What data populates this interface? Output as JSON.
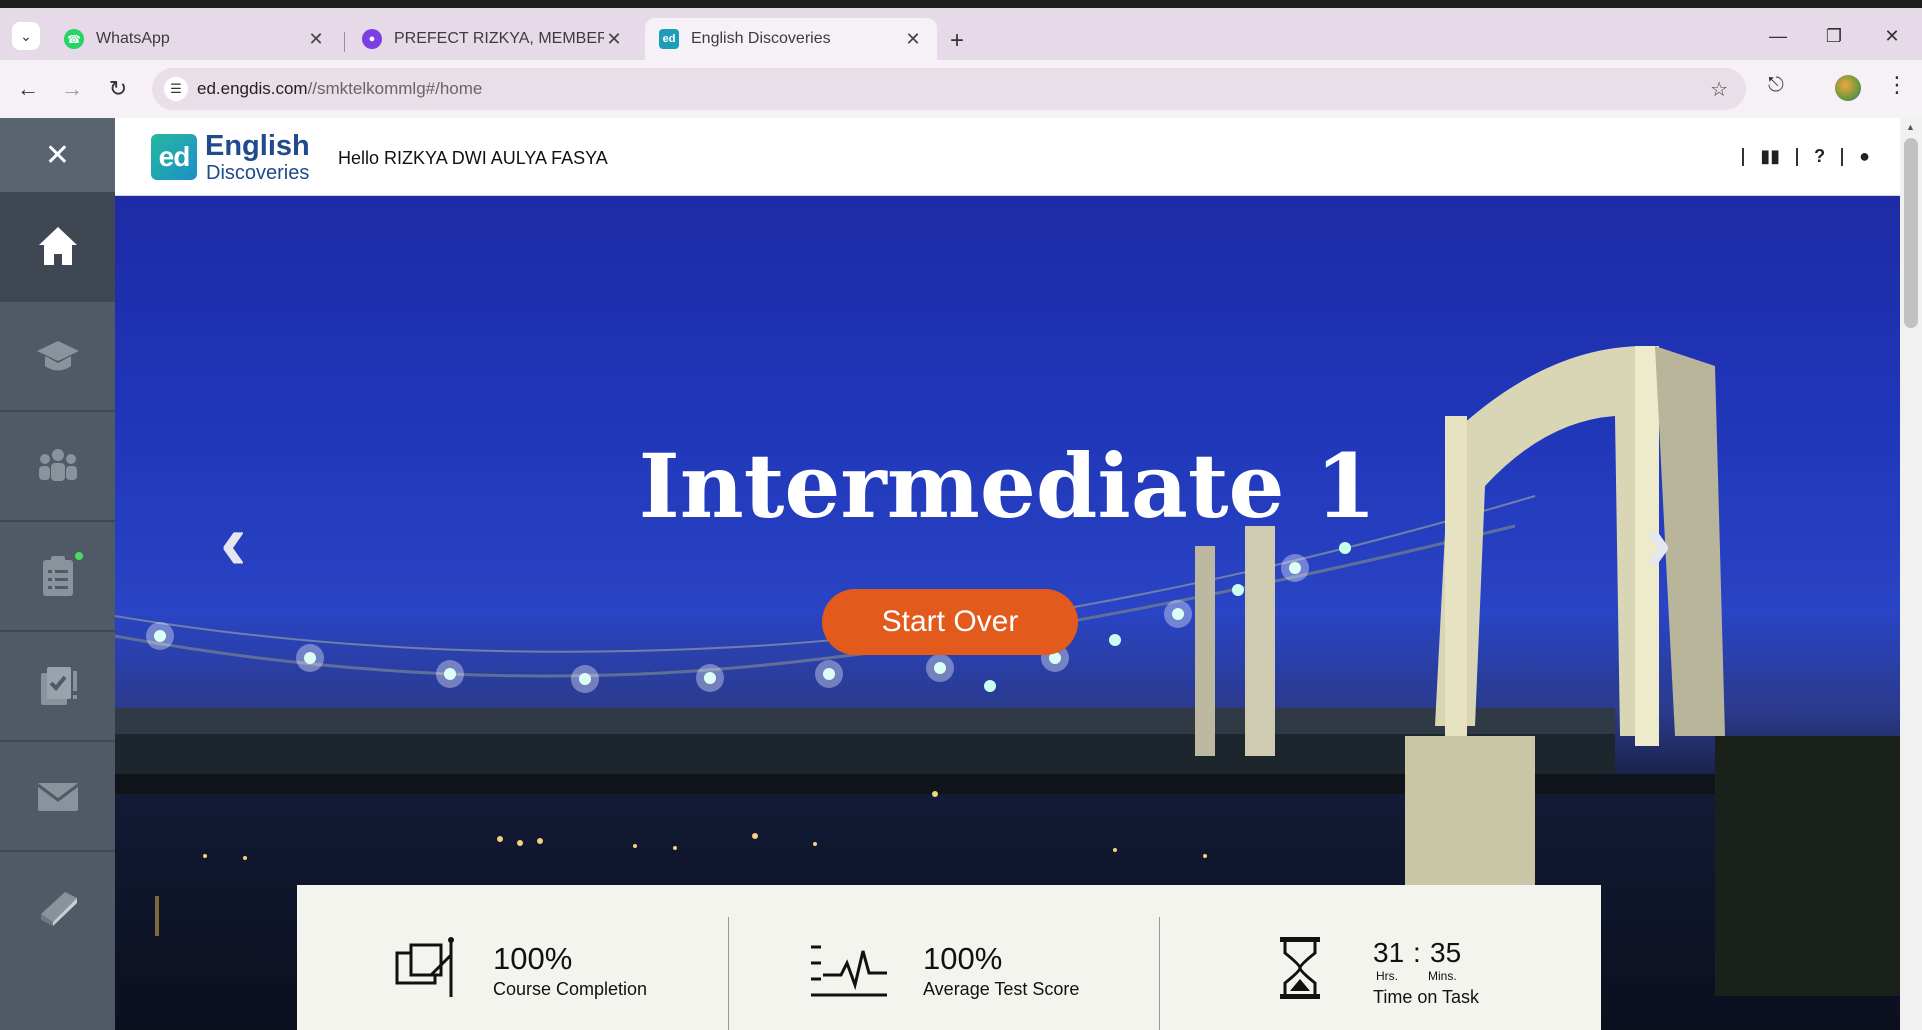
{
  "browser": {
    "tabs": [
      {
        "title": "WhatsApp",
        "icon": "whatsapp-icon",
        "color": "#25d366"
      },
      {
        "title": "PREFECT RIZKYA, MEMBER CINE",
        "icon": "canva-icon",
        "color": "#7b3fe4"
      },
      {
        "title": "English Discoveries",
        "icon": "ed-icon",
        "color": "#1e9db8"
      }
    ],
    "url_host": "ed.engdis.com",
    "url_path": "//smktelkommlg#/home"
  },
  "header": {
    "logo_mark": "ed",
    "logo_line1": "English",
    "logo_line2": "Discoveries",
    "greeting": "Hello RIZKYA DWI AULYA FASYA"
  },
  "hero": {
    "title": "Intermediate 1",
    "button_label": "Start Over"
  },
  "stats": {
    "completion_value": "100%",
    "completion_label": "Course Completion",
    "test_value": "100%",
    "test_label": "Average Test Score",
    "time_hours": "31",
    "time_colon": ":",
    "time_minutes": "35",
    "hours_label": "Hrs.",
    "minutes_label": "Mins.",
    "time_label": "Time on Task"
  },
  "colors": {
    "accent_button": "#e25a1c",
    "sidebar": "#505a66",
    "brand": "#1f4b8c",
    "notification_dot": "#4cd964"
  }
}
